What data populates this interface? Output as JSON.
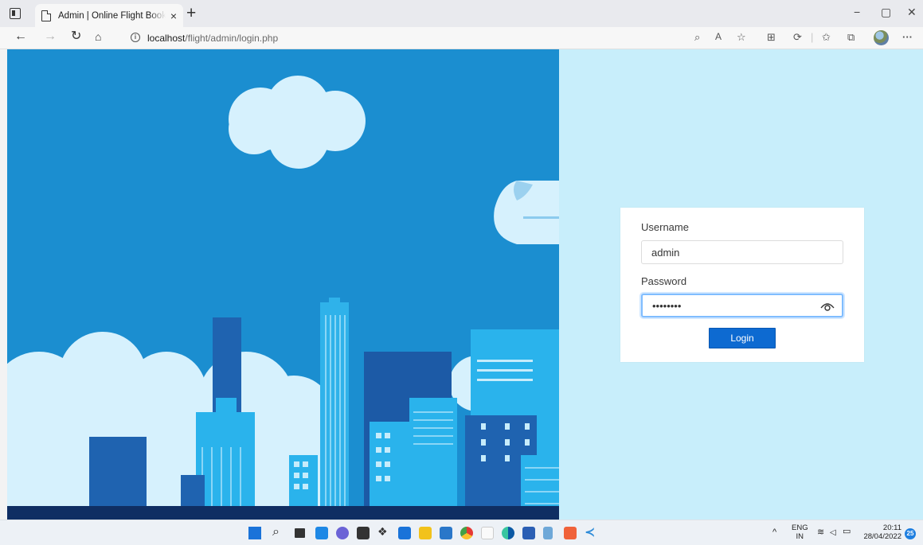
{
  "browser": {
    "tab_title": "Admin | Online Flight Booking Sy",
    "tab_close": "×",
    "new_tab": "+",
    "url_host": "localhost",
    "url_path": "/flight/admin/login.php",
    "window_controls": {
      "minimize": "−",
      "restore": "▢",
      "close": "✕"
    },
    "nav_icons": [
      "back-icon",
      "forward-icon",
      "refresh-icon",
      "home-icon"
    ],
    "right_icons": [
      "search-icon",
      "read-aloud-icon",
      "favorite-add-icon",
      "shopping-icon",
      "extensions-icon",
      "favorites-icon",
      "collections-icon",
      "profile-avatar",
      "more-icon"
    ],
    "more_label": "···"
  },
  "login": {
    "username_label": "Username",
    "username_value": "admin",
    "password_label": "Password",
    "password_value": "••••••••",
    "submit_label": "Login"
  },
  "taskbar": {
    "icons": [
      "windows-start-icon",
      "search-icon",
      "task-view-icon",
      "widgets-icon",
      "chat-icon",
      "store-icon",
      "dropbox-icon",
      "app-icon",
      "file-explorer-icon",
      "mail-icon",
      "chrome-icon",
      "app-icon",
      "edge-icon",
      "word-icon",
      "notepad-icon",
      "xampp-icon",
      "vscode-icon"
    ],
    "tray": {
      "lang_top": "ENG",
      "lang_bottom": "IN",
      "time": "20:11",
      "date": "28/04/2022",
      "notifications": "25"
    }
  },
  "colors": {
    "sky": "#1b8ed0",
    "page_bg": "#c8eefb",
    "button": "#0d6ad1",
    "focus_ring": "#80bdff"
  }
}
